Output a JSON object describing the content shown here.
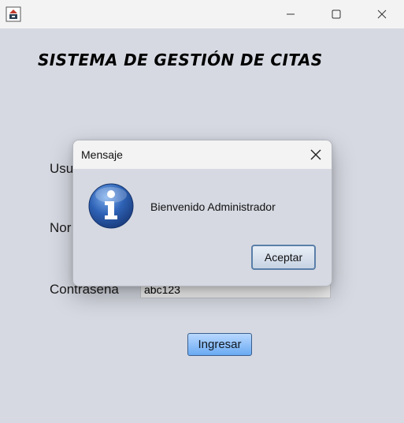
{
  "window": {
    "app_icon": "java-cup-icon"
  },
  "main": {
    "title": "SISTEMA DE GESTIÓN DE CITAS",
    "usuario_label": "Usu",
    "nombre_label": "Nor",
    "contrasena_label": "Contrasena",
    "contrasena_value": "abc123",
    "ingresar_label": "Ingresar"
  },
  "dialog": {
    "title": "Mensaje",
    "icon": "info-icon",
    "message": "Bienvenido Administrador",
    "ok_label": "Aceptar"
  },
  "colors": {
    "background": "#d6d9e2",
    "primary_button": "#6aaaf2",
    "info_icon": "#2e62b5"
  }
}
